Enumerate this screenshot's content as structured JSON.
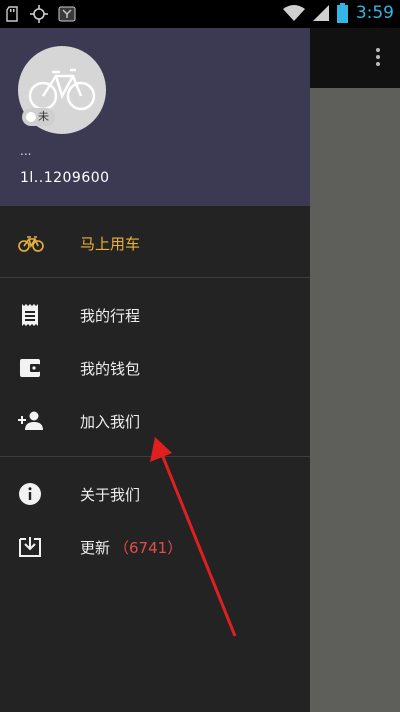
{
  "status_bar": {
    "time": "3:59",
    "icons": [
      "sd-card-icon",
      "gps-icon",
      "usb-debug-icon",
      "wifi-icon",
      "signal-icon",
      "battery-icon"
    ]
  },
  "drawer": {
    "header": {
      "avatar_badge": "未",
      "user_name": "...",
      "user_phone": "1l..1209600"
    },
    "primary": {
      "label": "马上用车",
      "icon": "bicycle-icon"
    },
    "items": [
      {
        "label": "我的行程",
        "icon": "receipt-icon"
      },
      {
        "label": "我的钱包",
        "icon": "wallet-icon"
      },
      {
        "label": "加入我们",
        "icon": "add-person-icon"
      }
    ],
    "secondary": [
      {
        "label": "关于我们",
        "icon": "info-icon"
      },
      {
        "label": "更新",
        "count": "（6741）",
        "icon": "download-icon"
      }
    ]
  },
  "colors": {
    "accent": "#e8b23a",
    "header_bg": "#3b3a52",
    "drawer_bg": "#232323",
    "update_count": "#e44b4b",
    "arrow": "#e02020",
    "time": "#33b5e5"
  }
}
